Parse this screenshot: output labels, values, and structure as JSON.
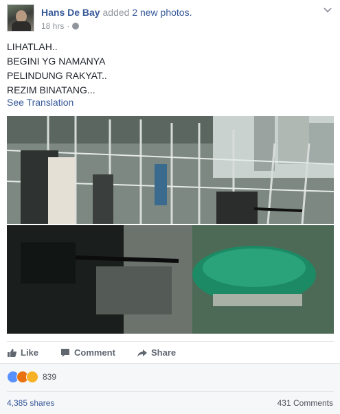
{
  "post": {
    "author": "Hans De Bay",
    "action_pre": "added",
    "action_count": "2 new photos.",
    "timestamp": "18 hrs",
    "separator": "·",
    "text_lines": [
      "LIHATLAH..",
      "BEGINI YG NAMANYA",
      "PELINDUNG RAKYAT..",
      "REZIM BINATANG..."
    ],
    "see_translation": "See Translation",
    "menu_icon": "chevron-down-icon"
  },
  "actions": {
    "like": "Like",
    "comment": "Comment",
    "share": "Share"
  },
  "stats": {
    "reaction_count": "839",
    "shares": "4,385 shares",
    "comments": "431 Comments",
    "reaction_icons": [
      "like-reaction-icon",
      "angry-reaction-icon",
      "wow-reaction-icon"
    ]
  },
  "colors": {
    "link": "#365899",
    "muted": "#90949c",
    "like_reaction": "#5890ff",
    "angry_reaction": "#e9710f",
    "wow_reaction": "#f7b125"
  }
}
